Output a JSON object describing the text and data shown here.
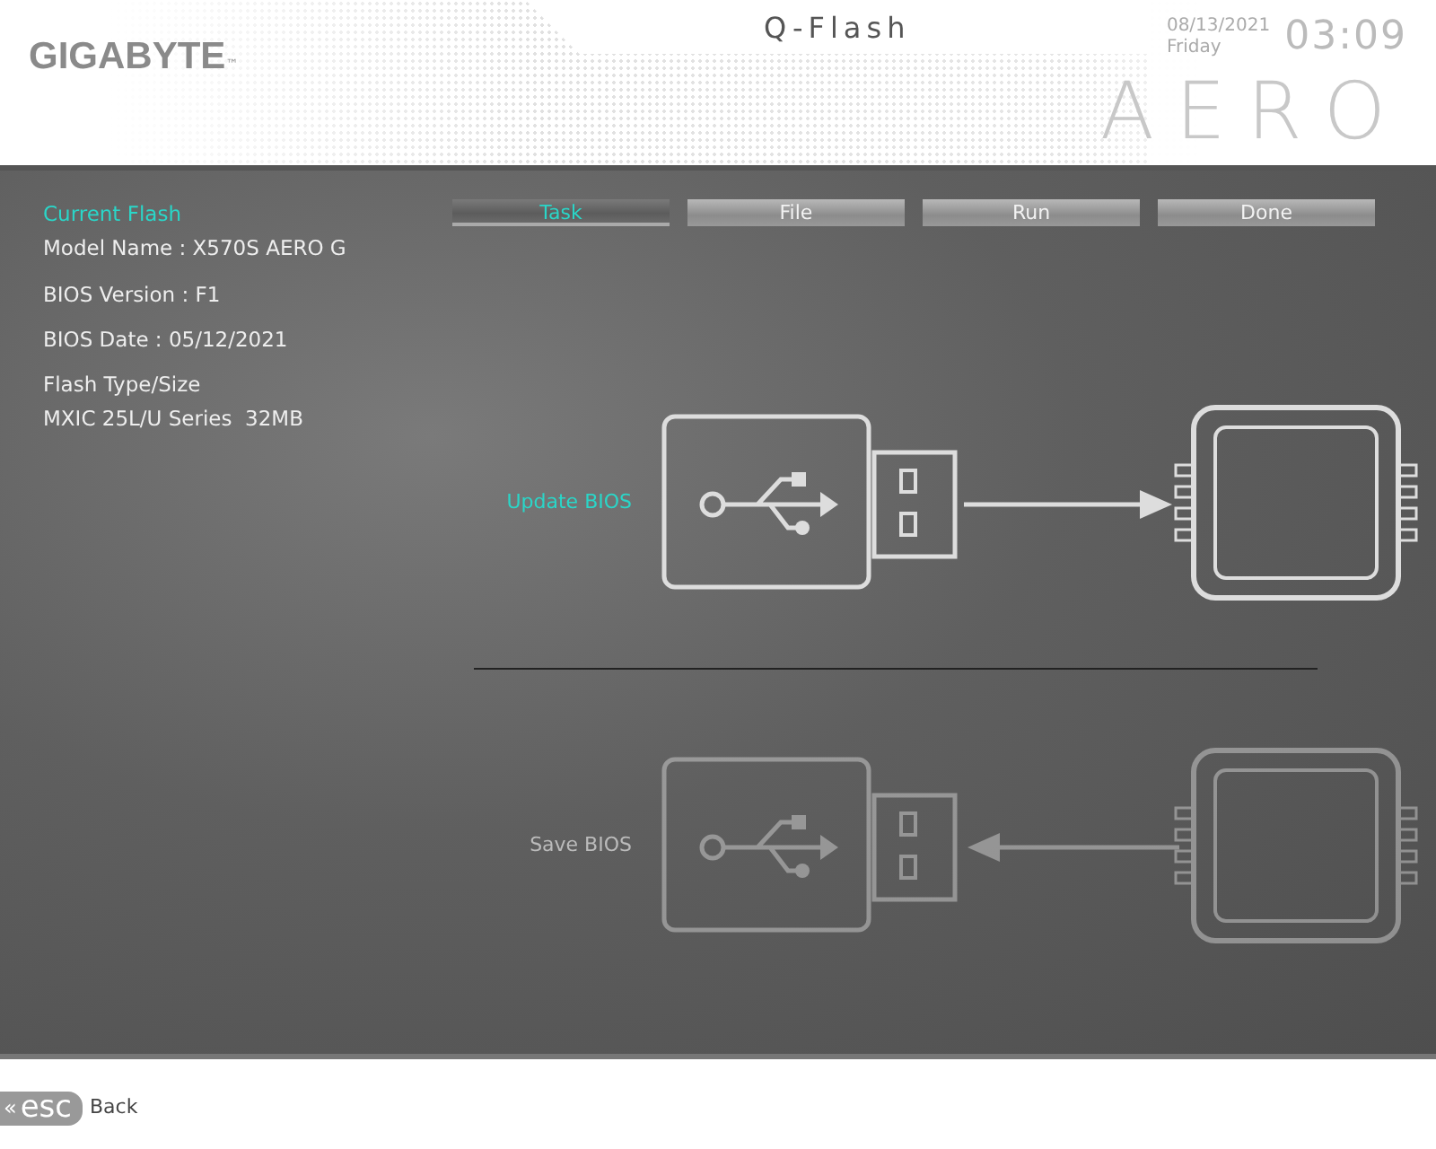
{
  "header": {
    "brand": "GIGABYTE",
    "trademark": "™",
    "title": "Q-Flash",
    "date": "08/13/2021",
    "weekday": "Friday",
    "time": "03:09",
    "series_logo": "AERO"
  },
  "current_flash": {
    "heading": "Current Flash",
    "lines": [
      "Model Name : X570S AERO G",
      "BIOS Version : F1",
      "BIOS Date : 05/12/2021",
      "Flash Type/Size",
      "MXIC 25L/U Series  32MB"
    ]
  },
  "steps": [
    {
      "label": "Task",
      "selected": true
    },
    {
      "label": "File",
      "selected": false
    },
    {
      "label": "Run",
      "selected": false
    },
    {
      "label": "Done",
      "selected": false
    }
  ],
  "actions": [
    {
      "label": "Update BIOS",
      "kind": "update",
      "selected": true
    },
    {
      "label": "Save BIOS",
      "kind": "save",
      "selected": false
    }
  ],
  "footer": {
    "key_symbol": "«",
    "key": "esc",
    "label": "Back"
  }
}
